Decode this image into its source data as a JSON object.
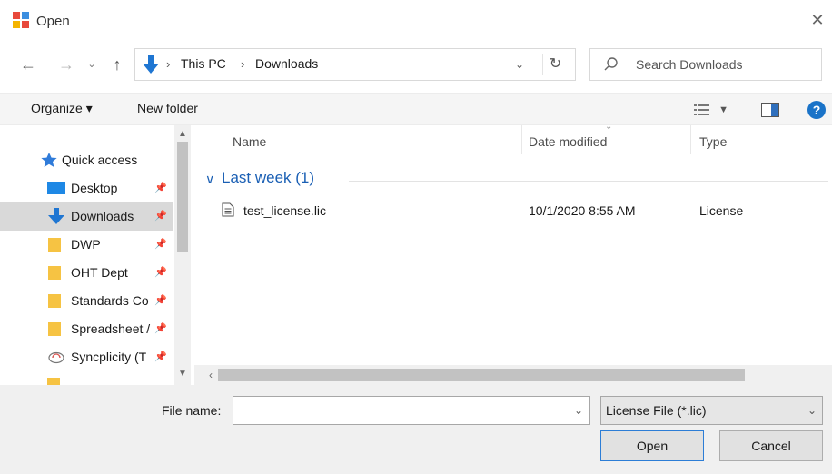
{
  "window": {
    "title": "Open",
    "close_icon": "close-icon"
  },
  "navigation": {
    "back_icon": "arrow-left-icon",
    "forward_icon": "arrow-right-icon",
    "recent_icon": "chevron-down-icon",
    "up_icon": "arrow-up-icon",
    "breadcrumb": [
      "This PC",
      "Downloads"
    ],
    "refresh_icon": "refresh-icon"
  },
  "search": {
    "placeholder": "Search Downloads"
  },
  "toolbar": {
    "organize_label": "Organize ▾",
    "new_folder_label": "New folder",
    "help_label": "?"
  },
  "sidebar": {
    "header": "Quick access",
    "items": [
      {
        "label": "Desktop",
        "icon": "desktop-icon"
      },
      {
        "label": "Downloads",
        "icon": "download-arrow-icon",
        "selected": true
      },
      {
        "label": "DWP",
        "icon": "folder-icon"
      },
      {
        "label": "OHT Dept",
        "icon": "folder-icon"
      },
      {
        "label": "Standards Co",
        "icon": "folder-icon"
      },
      {
        "label": "Spreadsheet /",
        "icon": "folder-icon"
      },
      {
        "label": "Syncplicity (T",
        "icon": "cloud-sync-icon"
      }
    ]
  },
  "filelist": {
    "columns": [
      "Name",
      "Date modified",
      "Type"
    ],
    "group_label": "Last week (1)",
    "files": [
      {
        "name": "test_license.lic",
        "date": "10/1/2020 8:55 AM",
        "type": "License"
      }
    ]
  },
  "bottom": {
    "filename_label": "File name:",
    "filename_value": "",
    "filter_value": "License File (*.lic)",
    "open_label": "Open",
    "cancel_label": "Cancel"
  },
  "colors": {
    "accent_blue": "#1a73c8",
    "group_blue": "#1a5fb4",
    "folder_yellow": "#f6c343",
    "selected_bg": "#d9d9d9"
  }
}
